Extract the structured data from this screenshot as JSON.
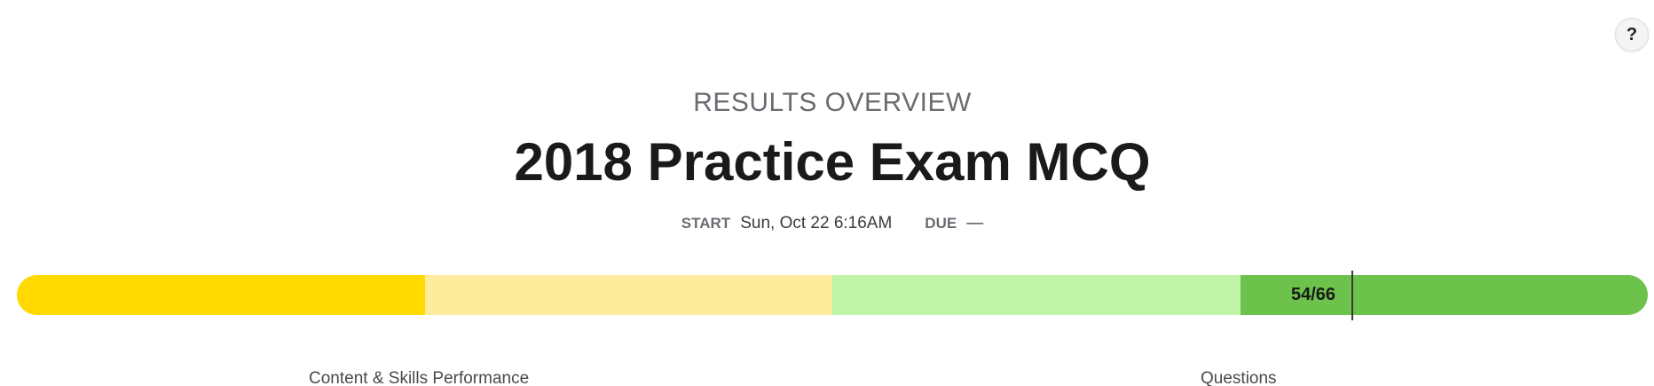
{
  "header": {
    "help_label": "?",
    "overview_label": "RESULTS OVERVIEW",
    "title": "2018 Practice Exam MCQ"
  },
  "dates": {
    "start_label": "START",
    "start_value": "Sun, Oct 22 6:16AM",
    "due_label": "DUE",
    "due_value": "—"
  },
  "score": {
    "label": "54/66",
    "correct": 54,
    "total": 66,
    "bands": [
      {
        "color": "#ffd900"
      },
      {
        "color": "#feeb9b"
      },
      {
        "color": "#bff4a9"
      },
      {
        "color": "#6cc24a"
      }
    ]
  },
  "sections": {
    "left_heading": "Content & Skills Performance",
    "right_heading": "Questions"
  }
}
